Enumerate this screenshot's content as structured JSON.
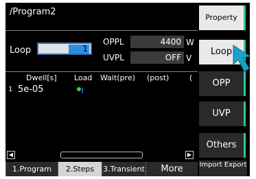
{
  "title": "/Program2",
  "loop": {
    "label": "Loop",
    "value": "1"
  },
  "oppl": {
    "label": "OPPL",
    "value": "4400",
    "unit": "W"
  },
  "uvpl": {
    "label": "UVPL",
    "value": "OFF",
    "unit": "V"
  },
  "table": {
    "headers": [
      "Dwell[s]",
      "Load",
      "Wait(pre)",
      "(post)",
      "("
    ],
    "rows": [
      {
        "index": "1",
        "dwell": "5e-05"
      }
    ]
  },
  "tabs": [
    "1.Program",
    "2.Steps",
    "3.Transient",
    "More"
  ],
  "side_buttons": {
    "property": "Property",
    "loop": "Loop",
    "opp": "OPP",
    "uvp": "UVP",
    "others": "Others",
    "import_export": "Import Export"
  },
  "colors": {
    "accent": "#2ec4a0",
    "selection": "#2f8de0",
    "cursor": "#1aa3c9",
    "load_indicator": "#38d838"
  }
}
